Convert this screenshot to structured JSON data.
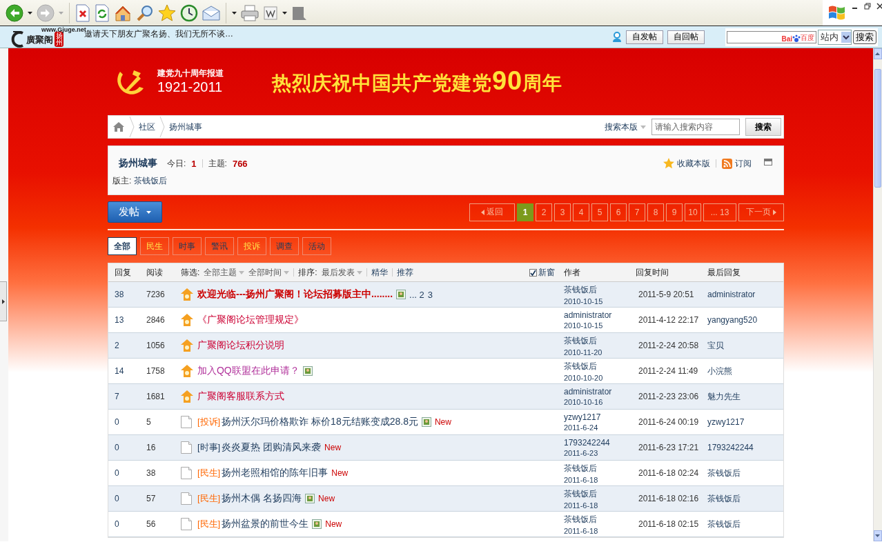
{
  "site_bar": {
    "logo_url": "www.Gjuge.net",
    "logo_text": "廣聚阁",
    "logo_seal": "扬州",
    "slogan": "邀请天下朋友广聚名扬、我们无所不谈…",
    "buttons": [
      "自发帖",
      "自回帖"
    ],
    "search": {
      "brand_latin": "Bai",
      "brand_cjk": "百度",
      "scope": "站内",
      "button": "搜索"
    }
  },
  "banner": {
    "subtitle": "建党九十周年报道",
    "years": "1921-2011",
    "headline": "热烈庆祝中国共产党建党**90**周年"
  },
  "breadcrumb": {
    "items": [
      "社区",
      "扬州城事"
    ],
    "search_scope": "搜索本版",
    "search_placeholder": "请输入搜索内容",
    "search_button": "搜索"
  },
  "forum": {
    "name": "扬州城事",
    "stats": [
      {
        "label": "今日:",
        "value": "1"
      },
      {
        "label": "主题:",
        "value": "766"
      }
    ],
    "actions": [
      {
        "kind": "star",
        "label": "收藏本版"
      },
      {
        "kind": "rss",
        "label": "订阅"
      }
    ],
    "moderator_label": "版主:",
    "moderator": "茶钱饭后"
  },
  "post_button": "发帖",
  "pagination": [
    {
      "kind": "prev",
      "label": "返回",
      "selected": false
    },
    {
      "kind": "page",
      "label": "1",
      "selected": true
    },
    {
      "kind": "page",
      "label": "2",
      "selected": false
    },
    {
      "kind": "page",
      "label": "3",
      "selected": false
    },
    {
      "kind": "page",
      "label": "4",
      "selected": false
    },
    {
      "kind": "page",
      "label": "5",
      "selected": false
    },
    {
      "kind": "page",
      "label": "6",
      "selected": false
    },
    {
      "kind": "page",
      "label": "7",
      "selected": false
    },
    {
      "kind": "page",
      "label": "8",
      "selected": false
    },
    {
      "kind": "page",
      "label": "9",
      "selected": false
    },
    {
      "kind": "page",
      "label": "10",
      "selected": false
    },
    {
      "kind": "page",
      "label": "... 13",
      "selected": false
    },
    {
      "kind": "next",
      "label": "下一页",
      "selected": false
    }
  ],
  "filter_tabs": [
    {
      "label": "全部",
      "selected": true,
      "highlighted": false
    },
    {
      "label": "民生",
      "selected": false,
      "highlighted": true
    },
    {
      "label": "时事",
      "selected": false,
      "highlighted": false
    },
    {
      "label": "警讯",
      "selected": false,
      "highlighted": false
    },
    {
      "label": "投诉",
      "selected": false,
      "highlighted": true
    },
    {
      "label": "调查",
      "selected": false,
      "highlighted": false
    },
    {
      "label": "活动",
      "selected": false,
      "highlighted": false
    }
  ],
  "table": {
    "header": {
      "replies": "回复",
      "views": "阅读",
      "filter_label": "筛选:",
      "filters": [
        "全部主题",
        "全部时间"
      ],
      "sort_label": "排序:",
      "sort_value": "最后发表",
      "links": [
        "精华",
        "推荐"
      ],
      "new_window": {
        "label": "新窗",
        "checked": true
      },
      "author": "作者",
      "reply_time": "回复时间",
      "last_reply": "最后回复"
    },
    "rows": [
      {
        "replies": "38",
        "views": "7236",
        "kind": "pinned",
        "title": "欢迎光临---扬州广聚阁！论坛招募版主中........",
        "color": "#cc0000",
        "bold": true,
        "attachment": true,
        "page_links": [
          "... 2",
          "3"
        ],
        "author": "茶钱饭后",
        "date": "2010-10-15",
        "reply_time": "2011-5-9 20:51",
        "last_reply": "administrator"
      },
      {
        "replies": "13",
        "views": "2846",
        "kind": "pinned",
        "title": "《广聚阁论坛管理规定》",
        "color": "#cc0033",
        "bold": false,
        "attachment": false,
        "author": "administrator",
        "date": "2010-10-15",
        "reply_time": "2011-4-12 22:17",
        "last_reply": "yangyang520"
      },
      {
        "replies": "2",
        "views": "1056",
        "kind": "pinned",
        "title": "广聚阁论坛积分说明",
        "color": "#cc0033",
        "bold": false,
        "attachment": false,
        "author": "茶钱饭后",
        "date": "2010-11-20",
        "reply_time": "2011-2-24 20:58",
        "last_reply": "宝贝"
      },
      {
        "replies": "14",
        "views": "1758",
        "kind": "pinned",
        "title": "加入QQ联盟在此申请？",
        "color": "#b0309a",
        "bold": false,
        "attachment": true,
        "author": "茶钱饭后",
        "date": "2010-10-20",
        "reply_time": "2011-2-24 11:49",
        "last_reply": "小浣熊"
      },
      {
        "replies": "7",
        "views": "1681",
        "kind": "pinned",
        "title": "广聚阁客服联系方式",
        "color": "#cc0033",
        "bold": false,
        "attachment": false,
        "author": "administrator",
        "date": "2010-10-16",
        "reply_time": "2011-2-23 23:06",
        "last_reply": "魅力先生"
      },
      {
        "replies": "0",
        "views": "5",
        "kind": "normal",
        "tag": {
          "text": "[投诉]",
          "color": "#ff6600"
        },
        "title": "扬州沃尔玛价格欺诈 标价18元结账变成28.8元",
        "color": "#1e3b5c",
        "bold": false,
        "attachment": true,
        "new_badge": "New",
        "author": "yzwy1217",
        "date": "2011-6-24",
        "reply_time": "2011-6-24 00:19",
        "last_reply": "yzwy1217"
      },
      {
        "replies": "0",
        "views": "16",
        "kind": "normal",
        "tag": {
          "text": "[时事]",
          "color": "#1e3b5c"
        },
        "title": "炎炎夏热 团购清风来袭",
        "color": "#1e3b5c",
        "bold": false,
        "attachment": false,
        "new_badge": "New",
        "author": "1793242244",
        "date": "2011-6-23",
        "reply_time": "2011-6-23 17:21",
        "last_reply": "1793242244"
      },
      {
        "replies": "0",
        "views": "38",
        "kind": "normal",
        "tag": {
          "text": "[民生]",
          "color": "#ff6600"
        },
        "title": "扬州老照相馆的陈年旧事",
        "color": "#1e3b5c",
        "bold": false,
        "attachment": false,
        "new_badge": "New",
        "author": "茶钱饭后",
        "date": "2011-6-18",
        "reply_time": "2011-6-18 02:24",
        "last_reply": "茶钱饭后"
      },
      {
        "replies": "0",
        "views": "57",
        "kind": "normal",
        "tag": {
          "text": "[民生]",
          "color": "#ff6600"
        },
        "title": "扬州木偶 名扬四海",
        "color": "#1e3b5c",
        "bold": false,
        "attachment": true,
        "new_badge": "New",
        "author": "茶钱饭后",
        "date": "2011-6-18",
        "reply_time": "2011-6-18 02:16",
        "last_reply": "茶钱饭后"
      },
      {
        "replies": "0",
        "views": "56",
        "kind": "normal",
        "tag": {
          "text": "[民生]",
          "color": "#ff6600"
        },
        "title": "扬州盆景的前世今生",
        "color": "#1e3b5c",
        "bold": false,
        "attachment": true,
        "new_badge": "New",
        "author": "茶钱饭后",
        "date": "2011-6-18",
        "reply_time": "2011-6-18 02:15",
        "last_reply": "茶钱饭后"
      }
    ]
  }
}
